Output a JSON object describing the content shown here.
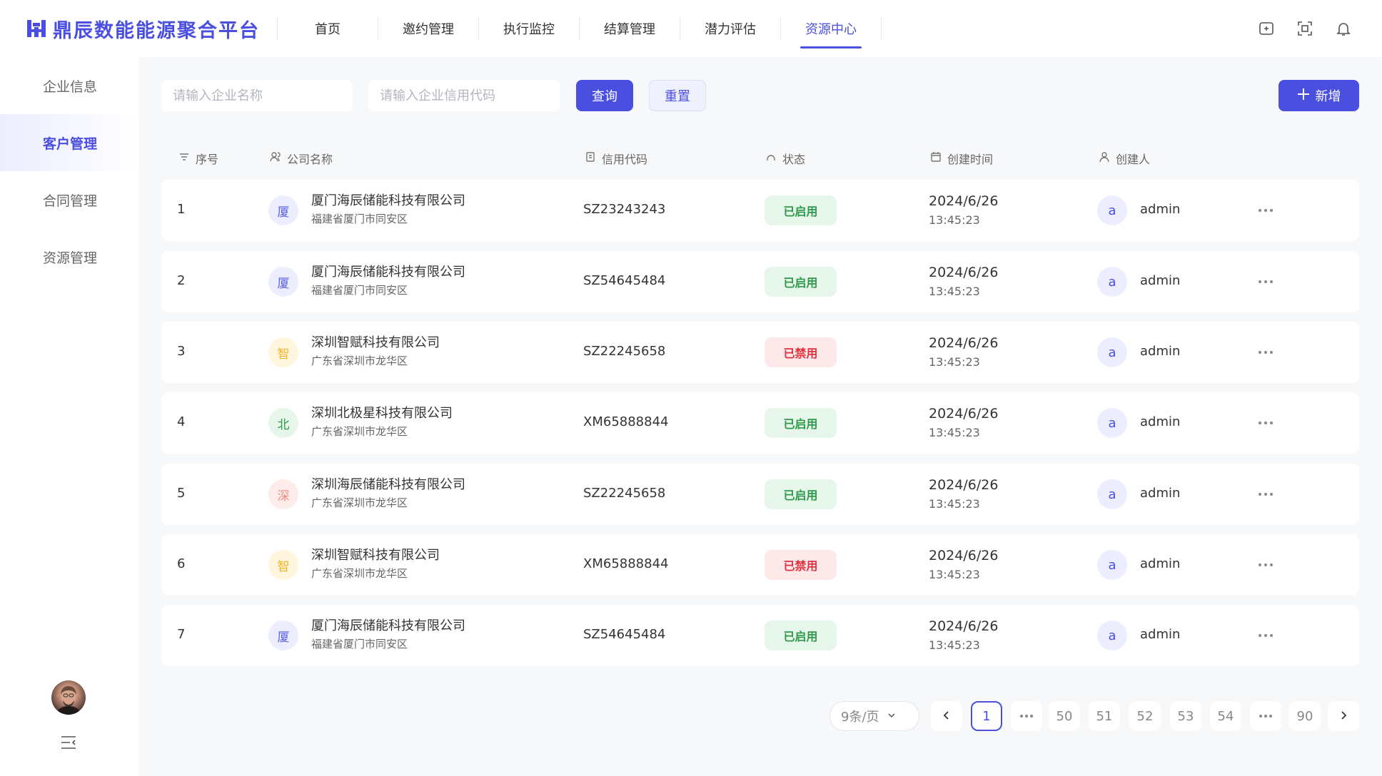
{
  "brand": {
    "name": "鼎辰数能能源聚合平台"
  },
  "nav": {
    "items": [
      {
        "label": "首页"
      },
      {
        "label": "邀约管理"
      },
      {
        "label": "执行监控"
      },
      {
        "label": "结算管理"
      },
      {
        "label": "潜力评估"
      },
      {
        "label": "资源中心"
      }
    ],
    "active": "资源中心"
  },
  "header_icons": [
    "screen-record-icon",
    "fullscreen-icon",
    "bell-icon"
  ],
  "sidebar": {
    "items": [
      {
        "label": "企业信息"
      },
      {
        "label": "客户管理"
      },
      {
        "label": "合同管理"
      },
      {
        "label": "资源管理"
      }
    ],
    "active": "客户管理"
  },
  "filters": {
    "company_placeholder": "请输入企业名称",
    "credit_placeholder": "请输入企业信用代码",
    "query_label": "查询",
    "reset_label": "重置",
    "add_label": "新增"
  },
  "table": {
    "headers": {
      "index": "序号",
      "company": "公司名称",
      "code": "信用代码",
      "status": "状态",
      "created": "创建时间",
      "creator": "创建人"
    },
    "rows": [
      {
        "index": "1",
        "badge": "厦",
        "badge_color": "#5b5fe0",
        "badge_bg": "#eceeff",
        "company": "厦门海辰储能科技有限公司",
        "region": "福建省厦门市同安区",
        "code": "SZ23243243",
        "status": "已启用",
        "status_type": "on",
        "date": "2024/6/26",
        "time": "13:45:23",
        "creator_initial": "a",
        "creator": "admin"
      },
      {
        "index": "2",
        "badge": "厦",
        "badge_color": "#5b5fe0",
        "badge_bg": "#eceeff",
        "company": "厦门海辰储能科技有限公司",
        "region": "福建省厦门市同安区",
        "code": "SZ54645484",
        "status": "已启用",
        "status_type": "on",
        "date": "2024/6/26",
        "time": "13:45:23",
        "creator_initial": "a",
        "creator": "admin"
      },
      {
        "index": "3",
        "badge": "智",
        "badge_color": "#f0b429",
        "badge_bg": "#fff6dd",
        "company": "深圳智赋科技有限公司",
        "region": "广东省深圳市龙华区",
        "code": "SZ22245658",
        "status": "已禁用",
        "status_type": "off",
        "date": "2024/6/26",
        "time": "13:45:23",
        "creator_initial": "a",
        "creator": "admin"
      },
      {
        "index": "4",
        "badge": "北",
        "badge_color": "#2f9a4a",
        "badge_bg": "#e6f6ea",
        "company": "深圳北极星科技有限公司",
        "region": "广东省深圳市龙华区",
        "code": "XM65888844",
        "status": "已启用",
        "status_type": "on",
        "date": "2024/6/26",
        "time": "13:45:23",
        "creator_initial": "a",
        "creator": "admin"
      },
      {
        "index": "5",
        "badge": "深",
        "badge_color": "#f08a7a",
        "badge_bg": "#fdecea",
        "company": "深圳海辰储能科技有限公司",
        "region": "广东省深圳市龙华区",
        "code": "SZ22245658",
        "status": "已启用",
        "status_type": "on",
        "date": "2024/6/26",
        "time": "13:45:23",
        "creator_initial": "a",
        "creator": "admin"
      },
      {
        "index": "6",
        "badge": "智",
        "badge_color": "#f0b429",
        "badge_bg": "#fff6dd",
        "company": "深圳智赋科技有限公司",
        "region": "广东省深圳市龙华区",
        "code": "XM65888844",
        "status": "已禁用",
        "status_type": "off",
        "date": "2024/6/26",
        "time": "13:45:23",
        "creator_initial": "a",
        "creator": "admin"
      },
      {
        "index": "7",
        "badge": "厦",
        "badge_color": "#5b5fe0",
        "badge_bg": "#eceeff",
        "company": "厦门海辰储能科技有限公司",
        "region": "福建省厦门市同安区",
        "code": "SZ54645484",
        "status": "已启用",
        "status_type": "on",
        "date": "2024/6/26",
        "time": "13:45:23",
        "creator_initial": "a",
        "creator": "admin"
      }
    ]
  },
  "pagination": {
    "page_size": "9条/页",
    "current": "1",
    "pages": [
      "1",
      "…",
      "50",
      "51",
      "52",
      "53",
      "54",
      "…",
      "90"
    ]
  },
  "colors": {
    "accent": "#4a4fe0",
    "status_on": "#2f9a4a",
    "status_off": "#e2323f"
  }
}
